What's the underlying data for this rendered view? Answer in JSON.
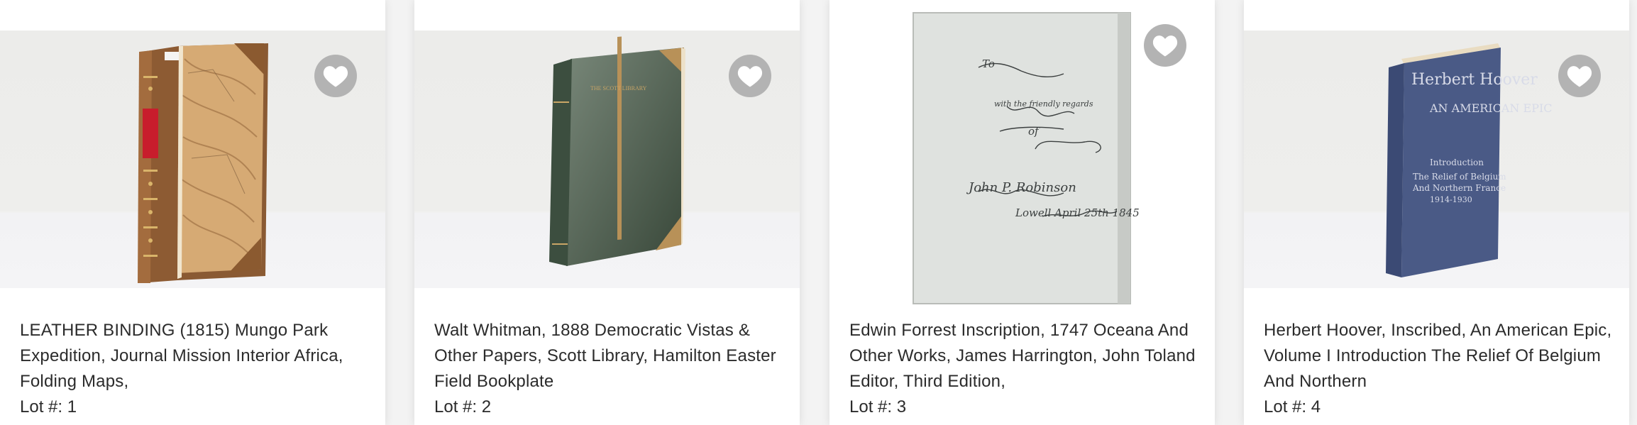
{
  "lots": [
    {
      "title": "LEATHER BINDING (1815) Mungo Park Expedition, Journal Mission Interior Africa, Folding Maps,",
      "lot_label": "Lot #: 1",
      "image_icon": "leather-book-icon",
      "spine_text": ""
    },
    {
      "title": "Walt Whitman, 1888 Democratic Vistas & Other Papers, Scott Library, Hamilton Easter Field Bookplate",
      "lot_label": "Lot #: 2",
      "image_icon": "green-book-icon",
      "spine_text": "THE SCOTT LIBRARY"
    },
    {
      "title": "Edwin Forrest Inscription, 1747 Oceana And Other Works, James Harrington, John Toland Editor, Third Edition,",
      "lot_label": "Lot #: 3",
      "image_icon": "inscribed-page-icon",
      "inscription": [
        "To",
        "with the friendly regards",
        "of",
        "John P. Robinson",
        "Lowell April 25th 1845"
      ]
    },
    {
      "title": "Herbert Hoover, Inscribed, An American Epic, Volume I Introduction The Relief Of Belgium And Northern",
      "lot_label": "Lot #: 4",
      "image_icon": "blue-book-icon",
      "cover_text": [
        "Herbert Hoover",
        "AN AMERICAN EPIC",
        "Introduction",
        "The Relief of Belgium",
        "And Northern France",
        "1914-1930"
      ]
    }
  ],
  "favorite_icon": "heart-icon",
  "colors": {
    "favorite_bg": "#b3b3b3",
    "text": "#2b2b2b",
    "card_bg": "#ffffff"
  }
}
